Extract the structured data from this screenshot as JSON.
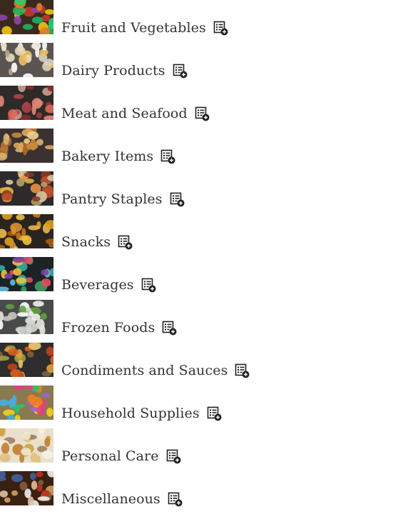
{
  "categories": [
    {
      "label": "Fruit and Vegetables",
      "bg": "#3a2a1e",
      "spots": [
        "#c0392b",
        "#f1c40f",
        "#27ae60",
        "#e67e22",
        "#8e44ad",
        "#2ecc71"
      ],
      "icon": "add-to-list-icon"
    },
    {
      "label": "Dairy Products",
      "bg": "#5a5550",
      "spots": [
        "#f5f0e6",
        "#e8dcc0",
        "#f0c060",
        "#ffffff",
        "#d9d2c0",
        "#b8a888"
      ],
      "icon": "add-to-list-icon"
    },
    {
      "label": "Meat and Seafood",
      "bg": "#2e2a28",
      "spots": [
        "#b0404a",
        "#d86a5a",
        "#8a2a30",
        "#e08878",
        "#a03a3a",
        "#c8a090"
      ],
      "icon": "add-to-list-icon"
    },
    {
      "label": "Bakery Items",
      "bg": "#3a3230",
      "spots": [
        "#c98a3c",
        "#e0a860",
        "#a86a28",
        "#d8b070",
        "#b87838",
        "#f0d090"
      ],
      "icon": "add-to-list-icon"
    },
    {
      "label": "Pantry Staples",
      "bg": "#2c2a2a",
      "spots": [
        "#c0502a",
        "#e0b040",
        "#d8c8a0",
        "#8a3a20",
        "#e89040",
        "#b0a070"
      ],
      "icon": "add-to-list-icon"
    },
    {
      "label": "Snacks",
      "bg": "#2a2420",
      "spots": [
        "#e0a020",
        "#c87818",
        "#f0c040",
        "#a86010",
        "#d89030",
        "#e8b850"
      ],
      "icon": "add-to-list-icon"
    },
    {
      "label": "Beverages",
      "bg": "#1c2226",
      "spots": [
        "#40a060",
        "#e05060",
        "#30b0a0",
        "#f0c040",
        "#8040a0",
        "#60c0e0"
      ],
      "icon": "add-to-list-icon"
    },
    {
      "label": "Frozen Foods",
      "bg": "#4a4a4a",
      "spots": [
        "#f0f0f0",
        "#e8e8e0",
        "#d0d8d0",
        "#60a040",
        "#ffffff",
        "#c8c8c0"
      ],
      "icon": "add-to-list-icon"
    },
    {
      "label": "Condiments and Sauces",
      "bg": "#2e2c2c",
      "spots": [
        "#c04020",
        "#e0a040",
        "#a0a040",
        "#d86020",
        "#806040",
        "#e8c070"
      ],
      "icon": "add-to-list-icon"
    },
    {
      "label": "Household Supplies",
      "bg": "#8a7a50",
      "spots": [
        "#40b0e0",
        "#f0d020",
        "#e04080",
        "#30c070",
        "#f08020",
        "#a060e0"
      ],
      "icon": "add-to-list-icon"
    },
    {
      "label": "Personal Care",
      "bg": "#e8e0cc",
      "spots": [
        "#d0a040",
        "#f0e8d0",
        "#c08030",
        "#e0c080",
        "#a08060",
        "#f8f0e0"
      ],
      "icon": "add-to-list-icon"
    },
    {
      "label": "Miscellaneous",
      "bg": "#3a2010",
      "spots": [
        "#c03020",
        "#e0c0a0",
        "#4060a0",
        "#f0f0f0",
        "#806040",
        "#d0a060"
      ],
      "icon": "add-to-list-icon"
    }
  ]
}
